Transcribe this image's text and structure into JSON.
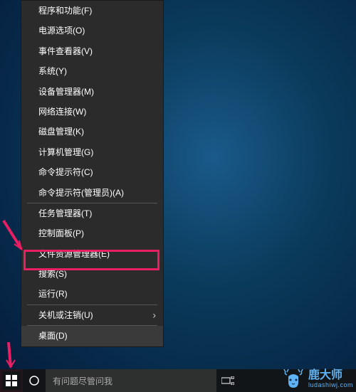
{
  "menu": {
    "items": [
      {
        "label": "程序和功能(F)"
      },
      {
        "label": "电源选项(O)"
      },
      {
        "label": "事件查看器(V)"
      },
      {
        "label": "系统(Y)"
      },
      {
        "label": "设备管理器(M)"
      },
      {
        "label": "网络连接(W)"
      },
      {
        "label": "磁盘管理(K)"
      },
      {
        "label": "计算机管理(G)"
      },
      {
        "label": "命令提示符(C)"
      },
      {
        "label": "命令提示符(管理员)(A)"
      }
    ],
    "group2": [
      {
        "label": "任务管理器(T)"
      },
      {
        "label": "控制面板(P)"
      },
      {
        "label": "文件资源管理器(E)"
      },
      {
        "label": "搜索(S)"
      },
      {
        "label": "运行(R)"
      }
    ],
    "group3": [
      {
        "label": "关机或注销(U)",
        "submenu": true
      }
    ],
    "group4": [
      {
        "label": "桌面(D)"
      }
    ]
  },
  "taskbar": {
    "search_placeholder": "有问题尽管问我"
  },
  "watermark": {
    "brand": "鹿大师",
    "domain": "ludashiwj.com"
  },
  "colors": {
    "highlight": "#e91e63",
    "menu_bg": "#2b2b2b",
    "desktop_bg": "#0a3a5a"
  }
}
